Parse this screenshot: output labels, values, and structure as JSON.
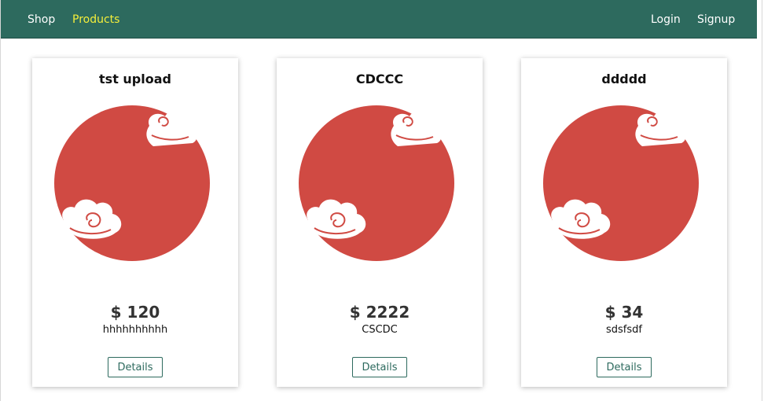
{
  "nav": {
    "left": [
      {
        "label": "Shop",
        "active": false
      },
      {
        "label": "Products",
        "active": true
      }
    ],
    "right": [
      {
        "label": "Login"
      },
      {
        "label": "Signup"
      }
    ]
  },
  "colors": {
    "navbar": "#2d6a5e",
    "nav_active": "#f4ee3a",
    "image_red": "#d04a43",
    "button_border": "#2d6a5e"
  },
  "products": [
    {
      "title": "tst upload",
      "price": "$ 120",
      "description": "hhhhhhhhhh",
      "button": "Details",
      "image_icon": "red-sun-cloud-image"
    },
    {
      "title": "CDCCC",
      "price": "$ 2222",
      "description": "CSCDC",
      "button": "Details",
      "image_icon": "red-sun-cloud-image"
    },
    {
      "title": "ddddd",
      "price": "$ 34",
      "description": "sdsfsdf",
      "button": "Details",
      "image_icon": "red-sun-cloud-image"
    }
  ]
}
